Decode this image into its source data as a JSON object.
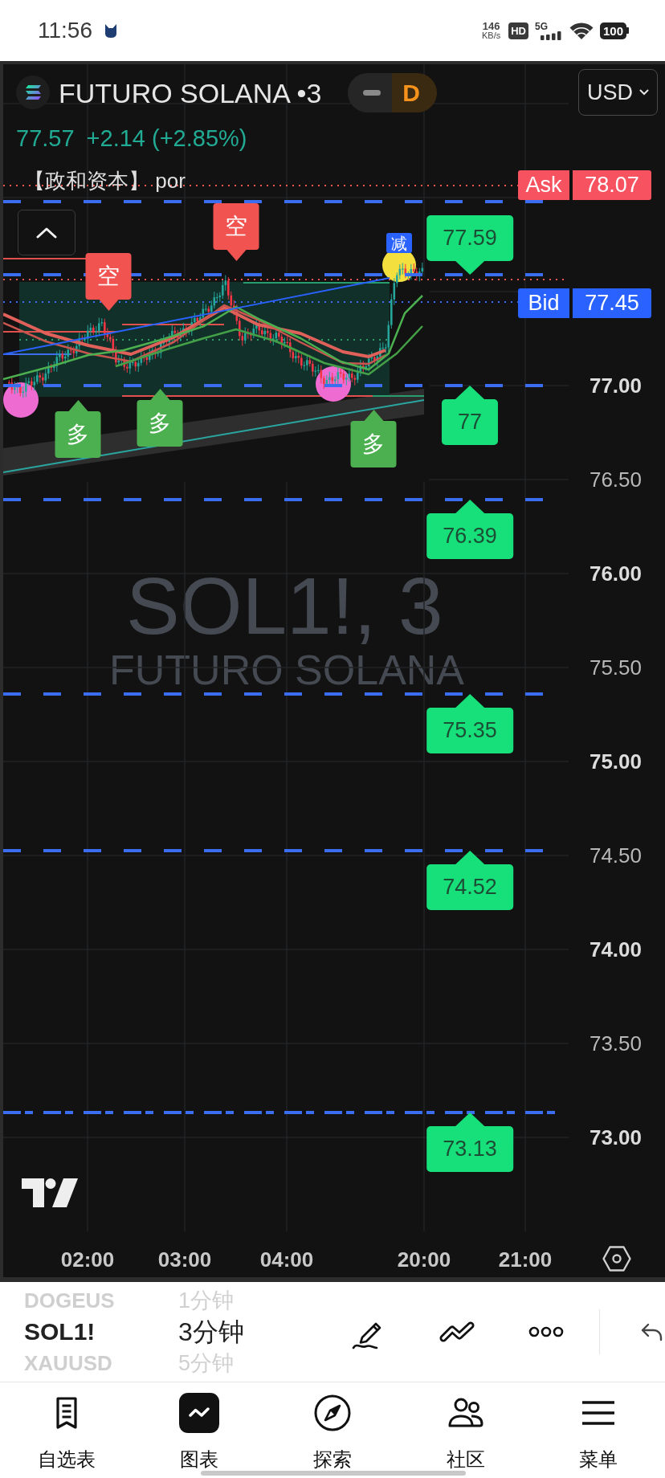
{
  "status_bar": {
    "time": "11:56",
    "net_speed": "146",
    "net_speed_unit": "KB/s",
    "hd": "HD",
    "network": "5G",
    "battery": "100"
  },
  "header": {
    "symbol": "FUTURO SOLANA •3",
    "status": "D",
    "currency": "USD",
    "last_price": "77.57",
    "change": "+2.14 (+2.85%)",
    "legend": "【政和资本】 por"
  },
  "chart": {
    "watermark": {
      "symbol": "SOL1!, 3",
      "name": "FUTURO SOLANA"
    },
    "quotes": [
      {
        "kind": "ask",
        "label": "Ask",
        "price": "78.07"
      },
      {
        "kind": "bid",
        "label": "Bid",
        "price": "77.45"
      }
    ],
    "price_axis": [
      {
        "label": "77.00",
        "major": true
      },
      {
        "label": "76.50",
        "major": false
      },
      {
        "label": "76.00",
        "major": true
      },
      {
        "label": "75.50",
        "major": false
      },
      {
        "label": "75.00",
        "major": true
      },
      {
        "label": "74.50",
        "major": false
      },
      {
        "label": "74.00",
        "major": true
      },
      {
        "label": "73.50",
        "major": false
      },
      {
        "label": "73.00",
        "major": true
      }
    ],
    "time_axis": [
      "02:00",
      "03:00",
      "04:00",
      "20:00",
      "21:00"
    ],
    "level_labels": [
      {
        "text": "77.59",
        "kind": "above"
      },
      {
        "text": "77",
        "kind": "below"
      },
      {
        "text": "76.39",
        "kind": "below"
      },
      {
        "text": "75.35",
        "kind": "below"
      },
      {
        "text": "74.52",
        "kind": "below"
      },
      {
        "text": "73.13",
        "kind": "below"
      }
    ],
    "signals": [
      {
        "kind": "short",
        "text": "空"
      },
      {
        "kind": "short",
        "text": "空"
      },
      {
        "kind": "long",
        "text": "多"
      },
      {
        "kind": "long",
        "text": "多"
      },
      {
        "kind": "long",
        "text": "多"
      },
      {
        "kind": "reduce",
        "text": "减"
      }
    ],
    "markers": [
      {
        "color": "#ee6bd2"
      },
      {
        "color": "#ee6bd2"
      },
      {
        "color": "#f3e03f"
      }
    ]
  },
  "toolbar": {
    "symbols": [
      {
        "text": "DOGEUS",
        "selected": false
      },
      {
        "text": "SOL1!",
        "selected": true
      },
      {
        "text": "XAUUSD",
        "selected": false
      }
    ],
    "intervals": [
      {
        "text": "1分钟",
        "selected": false
      },
      {
        "text": "3分钟",
        "selected": true
      },
      {
        "text": "5分钟",
        "selected": false
      }
    ]
  },
  "nav": [
    {
      "kind": "watchlist",
      "label": "自选表",
      "selected": false
    },
    {
      "kind": "chart",
      "label": "图表",
      "selected": true
    },
    {
      "kind": "explore",
      "label": "探索",
      "selected": false
    },
    {
      "kind": "community",
      "label": "社区",
      "selected": false
    },
    {
      "kind": "menu",
      "label": "菜单",
      "selected": false
    }
  ]
}
